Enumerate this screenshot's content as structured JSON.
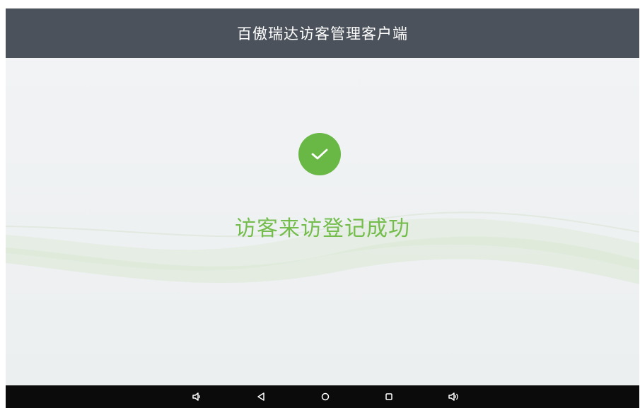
{
  "app": {
    "title": "百傲瑞达访客管理客户端"
  },
  "status": {
    "message": "访客来访登记成功",
    "icon": "check-circle-icon",
    "accent_color": "#69b845"
  },
  "system_nav": {
    "buttons": [
      {
        "name": "volume-down-icon"
      },
      {
        "name": "back-icon"
      },
      {
        "name": "home-icon"
      },
      {
        "name": "recent-apps-icon"
      },
      {
        "name": "volume-up-icon"
      }
    ]
  }
}
